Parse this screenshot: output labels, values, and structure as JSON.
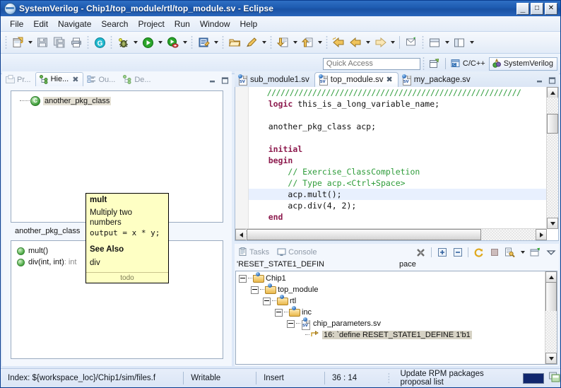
{
  "window": {
    "title": "SystemVerilog - Chip1/top_module/rtl/top_module.sv - Eclipse",
    "minimize_label": "_",
    "maximize_label": "□",
    "close_label": "✕"
  },
  "menu": {
    "items": [
      "File",
      "Edit",
      "Navigate",
      "Search",
      "Project",
      "Run",
      "Window",
      "Help"
    ]
  },
  "toolbar": {
    "groups": [
      {
        "buttons": [
          {
            "name": "new-file-icon",
            "arrow": true
          },
          {
            "name": "save-icon",
            "arrow": false
          },
          {
            "name": "save-all-icon",
            "arrow": false
          },
          {
            "name": "print-icon",
            "arrow": false
          }
        ]
      },
      {
        "buttons": [
          {
            "name": "compile-g-icon",
            "arrow": false
          }
        ]
      },
      {
        "buttons": [
          {
            "name": "debug-icon",
            "arrow": true
          },
          {
            "name": "run-icon",
            "arrow": true
          },
          {
            "name": "profile-icon",
            "arrow": true
          }
        ]
      },
      {
        "buttons": [
          {
            "name": "external-tools-icon",
            "arrow": true
          }
        ]
      },
      {
        "buttons": [
          {
            "name": "open-folder-icon",
            "arrow": false
          },
          {
            "name": "pen-icon",
            "arrow": true
          }
        ]
      },
      {
        "buttons": [
          {
            "name": "import-icon",
            "arrow": true
          },
          {
            "name": "export-icon",
            "arrow": true
          }
        ]
      },
      {
        "buttons": [
          {
            "name": "back-history-icon",
            "arrow": false
          },
          {
            "name": "back-icon",
            "arrow": true
          },
          {
            "name": "forward-icon",
            "arrow": true
          }
        ]
      },
      {
        "buttons": [
          {
            "name": "new-window-icon",
            "arrow": false
          }
        ]
      },
      {
        "buttons": [
          {
            "name": "split-horizontal-icon",
            "arrow": true
          },
          {
            "name": "split-vertical-icon",
            "arrow": true
          }
        ]
      }
    ]
  },
  "quick_access": {
    "placeholder": "Quick Access",
    "value": "",
    "open_perspective_icon": "open-perspective-icon",
    "perspectives": [
      {
        "label": "C/C++",
        "icon": "c-cpp-perspective-icon",
        "active": false
      },
      {
        "label": "SystemVerilog",
        "icon": "systemverilog-perspective-icon",
        "active": true
      }
    ]
  },
  "left_panel": {
    "tabs": [
      {
        "label": "Pr...",
        "icon": "project-explorer-icon",
        "active": false,
        "closable": false
      },
      {
        "label": "Hie...",
        "icon": "hierarchy-icon",
        "active": true,
        "closable": true
      },
      {
        "label": "Ou...",
        "icon": "outline-icon",
        "active": false,
        "closable": false
      },
      {
        "label": "De...",
        "icon": "declaration-icon",
        "active": false,
        "closable": false
      }
    ],
    "close_symbol": "✖",
    "minimize_symbol": "–",
    "maximize_symbol": "□",
    "tree": [
      {
        "label": "another_pkg_class",
        "icon": "class-icon",
        "selected": true
      }
    ],
    "member_header": "another_pkg_class",
    "members": [
      {
        "label": "mult()",
        "icon": "method-icon",
        "return_type": ""
      },
      {
        "label": "div(int, int)",
        "icon": "method-icon",
        "return_type": ": int"
      }
    ]
  },
  "editor": {
    "tabs": [
      {
        "label": "sub_module1.sv",
        "active": false,
        "closable": false
      },
      {
        "label": "top_module.sv",
        "active": true,
        "closable": true
      },
      {
        "label": "my_package.sv",
        "active": false,
        "closable": false
      }
    ],
    "close_symbol": "✖",
    "minimize_symbol": "–",
    "maximize_symbol": "□",
    "lines": [
      {
        "segments": [
          {
            "text": "    ////////////////////////////////////////////////////////",
            "cls": "cmt-line"
          }
        ]
      },
      {
        "segments": [
          {
            "text": "    "
          },
          {
            "text": "logic",
            "cls": "kw"
          },
          {
            "text": " this_is_a_long_variable_name;"
          }
        ]
      },
      {
        "segments": [
          {
            "text": ""
          }
        ]
      },
      {
        "segments": [
          {
            "text": "    another_pkg_class acp;"
          }
        ]
      },
      {
        "segments": [
          {
            "text": ""
          }
        ]
      },
      {
        "segments": [
          {
            "text": "    "
          },
          {
            "text": "initial",
            "cls": "kw"
          }
        ]
      },
      {
        "segments": [
          {
            "text": "    "
          },
          {
            "text": "begin",
            "cls": "kw"
          }
        ]
      },
      {
        "segments": [
          {
            "text": "        "
          },
          {
            "text": "// Exercise_ClassCompletion",
            "cls": "cmt"
          }
        ]
      },
      {
        "segments": [
          {
            "text": "        "
          },
          {
            "text": "// Type acp.<Ctrl+Space>",
            "cls": "cmt"
          }
        ]
      },
      {
        "highlight": true,
        "segments": [
          {
            "text": "        acp.mult();"
          }
        ]
      },
      {
        "segments": [
          {
            "text": "        acp.div(4, 2);"
          }
        ]
      },
      {
        "segments": [
          {
            "text": "    "
          },
          {
            "text": "end",
            "cls": "kw"
          }
        ]
      }
    ]
  },
  "tooltip": {
    "title": "mult",
    "description": "Multiply two numbers",
    "code": "output = x * y;",
    "see_also_heading": "See Also",
    "see_also": "div",
    "footer": "todo"
  },
  "bottom_panel": {
    "tabs": [
      {
        "label": "Tasks",
        "icon": "tasks-icon",
        "active": false
      },
      {
        "label": "Console",
        "icon": "console-icon",
        "active": false
      }
    ],
    "minimize_symbol": "–",
    "maximize_symbol": "□",
    "toolbar": [
      {
        "name": "clear-icon"
      },
      {
        "name": "expand-all-icon"
      },
      {
        "name": "collapse-all-icon"
      },
      {
        "name": "refresh-icon"
      },
      {
        "name": "stop-icon"
      },
      {
        "name": "configure-icon",
        "arrow": true
      },
      {
        "name": "new-view-icon"
      },
      {
        "name": "view-menu-icon"
      }
    ],
    "filter_text": "'RESET_STATE1_DEFIN",
    "filter_text_tail": "pace",
    "tree": [
      {
        "label": "Chip1",
        "depth": 0,
        "icon": "folder-icon",
        "expanded": true
      },
      {
        "label": "top_module",
        "depth": 1,
        "icon": "folder-icon",
        "expanded": true
      },
      {
        "label": "rtl",
        "depth": 2,
        "icon": "folder-icon",
        "expanded": true
      },
      {
        "label": "inc",
        "depth": 3,
        "icon": "folder-icon",
        "expanded": true
      },
      {
        "label": "chip_parameters.sv",
        "depth": 4,
        "icon": "sv-file-icon",
        "expanded": true
      },
      {
        "label": "16: `define RESET_STATE1_DEFINE 1'b1",
        "depth": 5,
        "icon": "match-icon",
        "expanded": false,
        "selected": true
      }
    ]
  },
  "status_bar": {
    "index": "Index: ${workspace_loc}/Chip1/sim/files.f",
    "writable": "Writable",
    "insert_mode": "Insert",
    "position": "36 : 14",
    "job": "Update RPM packages proposal list",
    "progress_icon": "progress-bar",
    "jobs_icon": "jobs-icon"
  }
}
